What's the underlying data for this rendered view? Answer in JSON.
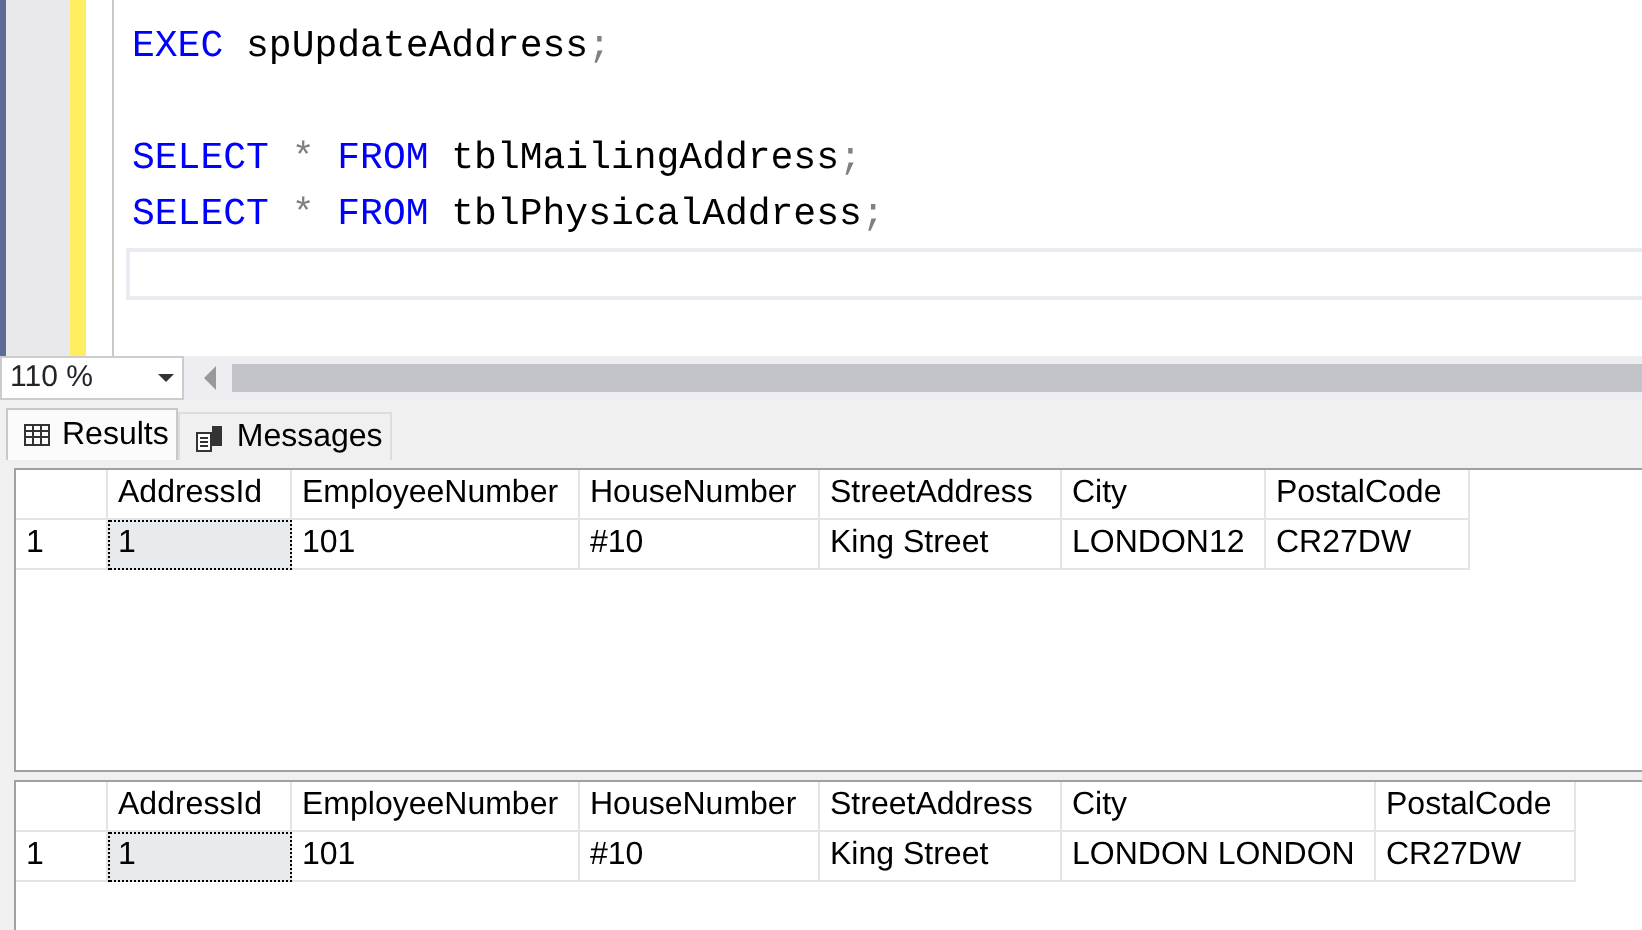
{
  "editor": {
    "lines": [
      {
        "kind": "code",
        "tokens": [
          {
            "kind": "keyword",
            "text": "EXEC "
          },
          {
            "kind": "identifier",
            "text": "spUpdateAddress"
          },
          {
            "kind": "punct",
            "text": ";"
          }
        ]
      },
      {
        "kind": "blank"
      },
      {
        "kind": "code",
        "tokens": [
          {
            "kind": "keyword",
            "text": "SELECT "
          },
          {
            "kind": "punct",
            "text": "* "
          },
          {
            "kind": "keyword",
            "text": "FROM "
          },
          {
            "kind": "identifier",
            "text": "tblMailingAddress"
          },
          {
            "kind": "punct",
            "text": ";"
          }
        ]
      },
      {
        "kind": "code",
        "tokens": [
          {
            "kind": "keyword",
            "text": "SELECT "
          },
          {
            "kind": "punct",
            "text": "* "
          },
          {
            "kind": "keyword",
            "text": "FROM "
          },
          {
            "kind": "identifier",
            "text": "tblPhysicalAddress"
          },
          {
            "kind": "punct",
            "text": ";"
          }
        ]
      }
    ]
  },
  "zoom": {
    "value": "110 %"
  },
  "tabs": [
    {
      "label": "Results",
      "selected": true
    },
    {
      "label": "Messages",
      "selected": false
    }
  ],
  "grids": [
    {
      "columns": [
        "AddressId",
        "EmployeeNumber",
        "HouseNumber",
        "StreetAddress",
        "City",
        "PostalCode"
      ],
      "rows": [
        {
          "number": "1",
          "cells": [
            {
              "text": "1",
              "selected": true
            },
            {
              "text": "101",
              "selected": false
            },
            {
              "text": "#10",
              "selected": false
            },
            {
              "text": "King Street",
              "selected": false
            },
            {
              "text": "LONDON12",
              "selected": false
            },
            {
              "text": "CR27DW",
              "selected": false
            }
          ]
        }
      ]
    },
    {
      "columns": [
        "AddressId",
        "EmployeeNumber",
        "HouseNumber",
        "StreetAddress",
        "City",
        "PostalCode"
      ],
      "rows": [
        {
          "number": "1",
          "cells": [
            {
              "text": "1",
              "selected": true
            },
            {
              "text": "101",
              "selected": false
            },
            {
              "text": "#10",
              "selected": false
            },
            {
              "text": "King Street",
              "selected": false
            },
            {
              "text": "LONDON LONDON",
              "selected": false
            },
            {
              "text": "CR27DW",
              "selected": false
            }
          ]
        }
      ]
    }
  ]
}
